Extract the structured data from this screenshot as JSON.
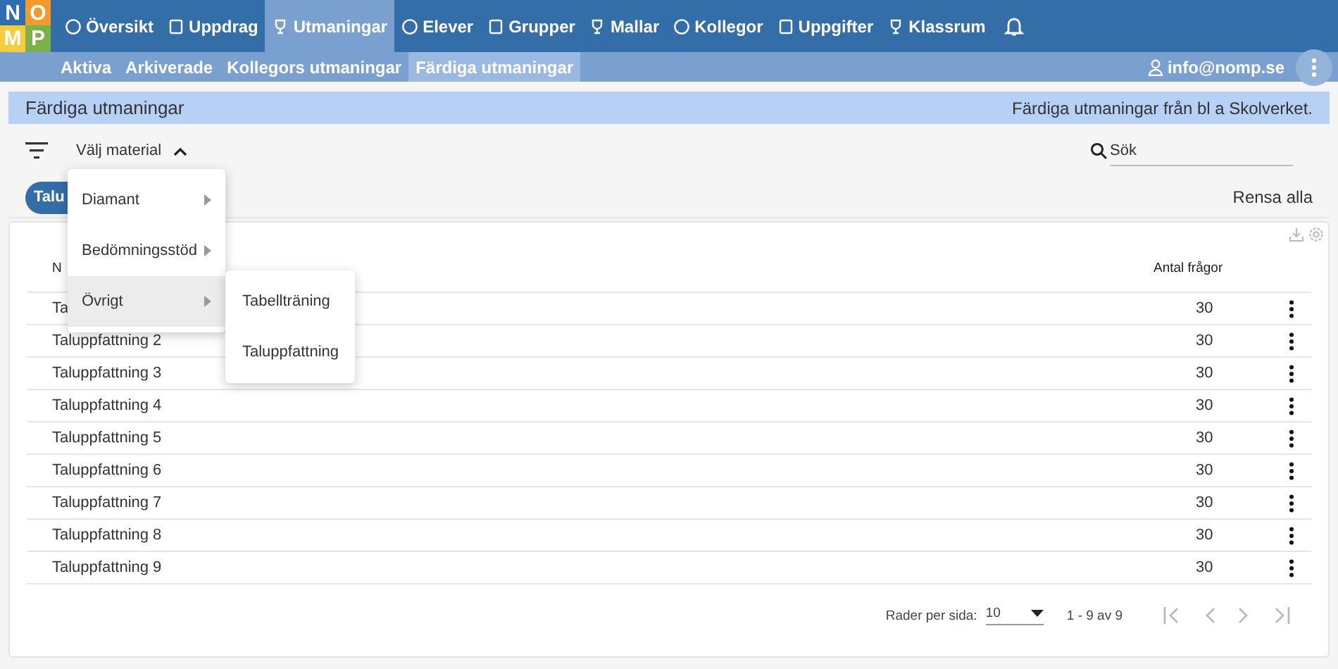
{
  "logo": {
    "letters": [
      {
        "text": "N",
        "color": "#2f6db3"
      },
      {
        "text": "O",
        "color": "#f39a2b"
      },
      {
        "text": "M",
        "color": "#f5cd3c"
      },
      {
        "text": "P",
        "color": "#7bb04a"
      }
    ]
  },
  "nav": {
    "items": [
      {
        "label": "Översikt",
        "selected": false
      },
      {
        "label": "Uppdrag",
        "selected": false
      },
      {
        "label": "Utmaningar",
        "selected": true
      },
      {
        "label": "Elever",
        "selected": false
      },
      {
        "label": "Grupper",
        "selected": false
      },
      {
        "label": "Mallar",
        "selected": false
      },
      {
        "label": "Kollegor",
        "selected": false
      },
      {
        "label": "Uppgifter",
        "selected": false
      },
      {
        "label": "Klassrum",
        "selected": false
      }
    ]
  },
  "subnav": {
    "items": [
      {
        "label": "Aktiva",
        "selected": false
      },
      {
        "label": "Arkiverade",
        "selected": false
      },
      {
        "label": "Kollegors utmaningar",
        "selected": false
      },
      {
        "label": "Färdiga utmaningar",
        "selected": true
      }
    ],
    "user": "info@nomp.se"
  },
  "header": {
    "title": "Färdiga utmaningar",
    "description": "Färdiga utmaningar från bl a Skolverket."
  },
  "toolbar": {
    "select_label": "Välj material",
    "search": {
      "placeholder": "Sök"
    },
    "chip": "Talu",
    "clear": "Rensa alla"
  },
  "menu": {
    "items": [
      {
        "label": "Diamant",
        "selected": false
      },
      {
        "label": "Bedömningsstöd",
        "selected": false
      },
      {
        "label": "Övrigt",
        "selected": true
      }
    ],
    "submenu": [
      "Tabellträning",
      "Taluppfattning"
    ]
  },
  "table": {
    "columns": [
      "N",
      "Antal frågor"
    ],
    "rows": [
      {
        "name": "Ta",
        "count": "30"
      },
      {
        "name": "Taluppfattning 2",
        "count": "30"
      },
      {
        "name": "Taluppfattning 3",
        "count": "30"
      },
      {
        "name": "Taluppfattning 4",
        "count": "30"
      },
      {
        "name": "Taluppfattning 5",
        "count": "30"
      },
      {
        "name": "Taluppfattning 6",
        "count": "30"
      },
      {
        "name": "Taluppfattning 7",
        "count": "30"
      },
      {
        "name": "Taluppfattning 8",
        "count": "30"
      },
      {
        "name": "Taluppfattning 9",
        "count": "30"
      }
    ]
  },
  "pagination": {
    "rows_label": "Rader per sida:",
    "rows_value": "10",
    "range": "1 - 9 av 9"
  }
}
